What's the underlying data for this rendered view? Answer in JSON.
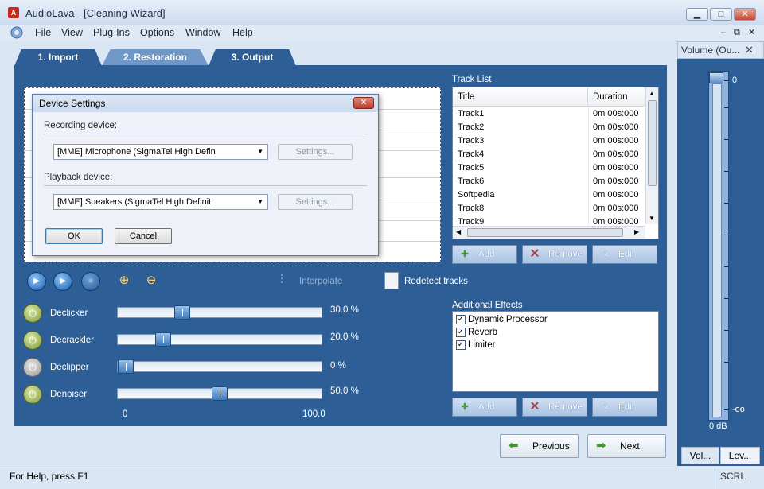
{
  "window": {
    "title": "AudioLava - [Cleaning Wizard]",
    "minimize": "▁",
    "maximize": "□",
    "close": "✕"
  },
  "menu": {
    "file": "File",
    "view": "View",
    "plugins": "Plug-Ins",
    "options": "Options",
    "window": "Window",
    "help": "Help",
    "mdi_min": "‒",
    "mdi_restore": "⧉",
    "mdi_close": "✕"
  },
  "tabs": {
    "import": "1. Import",
    "restoration": "2. Restoration",
    "output": "3. Output"
  },
  "dialog": {
    "title": "Device Settings",
    "recording_label": "Recording device:",
    "recording_value": "[MME] Microphone (SigmaTel High Defin",
    "playback_label": "Playback device:",
    "playback_value": "[MME] Speakers (SigmaTel High Definit",
    "settings_label": "Settings...",
    "ok": "OK",
    "cancel": "Cancel"
  },
  "toolbar": {
    "interpolate": "Interpolate",
    "redetect": "Redetect tracks"
  },
  "effects": {
    "declicker": {
      "label": "Declicker",
      "value": "30.0 %",
      "level": 30.0,
      "on": true
    },
    "decrackler": {
      "label": "Decrackler",
      "value": "20.0 %",
      "level": 20.0,
      "on": true
    },
    "declipper": {
      "label": "Declipper",
      "value": "0 %",
      "level": 0,
      "on": false
    },
    "denoiser": {
      "label": "Denoiser",
      "value": "50.0 %",
      "level": 50.0,
      "on": true
    },
    "scale_min": "0",
    "scale_max": "100.0"
  },
  "track_list": {
    "heading": "Track List",
    "col_title": "Title",
    "col_duration": "Duration",
    "rows": [
      {
        "title": "Track1",
        "duration": "0m 00s:000"
      },
      {
        "title": "Track2",
        "duration": "0m 00s:000"
      },
      {
        "title": "Track3",
        "duration": "0m 00s:000"
      },
      {
        "title": "Track4",
        "duration": "0m 00s:000"
      },
      {
        "title": "Track5",
        "duration": "0m 00s:000"
      },
      {
        "title": "Track6",
        "duration": "0m 00s:000"
      },
      {
        "title": "Softpedia",
        "duration": "0m 00s:000"
      },
      {
        "title": "Track8",
        "duration": "0m 00s:000"
      },
      {
        "title": "Track9",
        "duration": "0m 00s:000"
      }
    ]
  },
  "buttons": {
    "add": "Add",
    "remove": "Remove",
    "edit": "Edit",
    "previous": "Previous",
    "next": "Next"
  },
  "additional_effects": {
    "heading": "Additional Effects",
    "items": [
      {
        "label": "Dynamic Processor",
        "checked": true
      },
      {
        "label": "Reverb",
        "checked": true
      },
      {
        "label": "Limiter",
        "checked": true
      }
    ]
  },
  "volume_panel": {
    "title": "Volume (Ou...",
    "top_label": "0",
    "bottom_label": "-oo",
    "readout": "0 dB",
    "tab_volume": "Vol...",
    "tab_levels": "Lev..."
  },
  "status": {
    "help": "For Help, press F1",
    "scrl": "SCRL"
  },
  "colors": {
    "panel": "#2d5e95",
    "active_tab": "#6f98c8",
    "add_icon": "#3c9a2b",
    "remove_icon": "#c0382a"
  }
}
